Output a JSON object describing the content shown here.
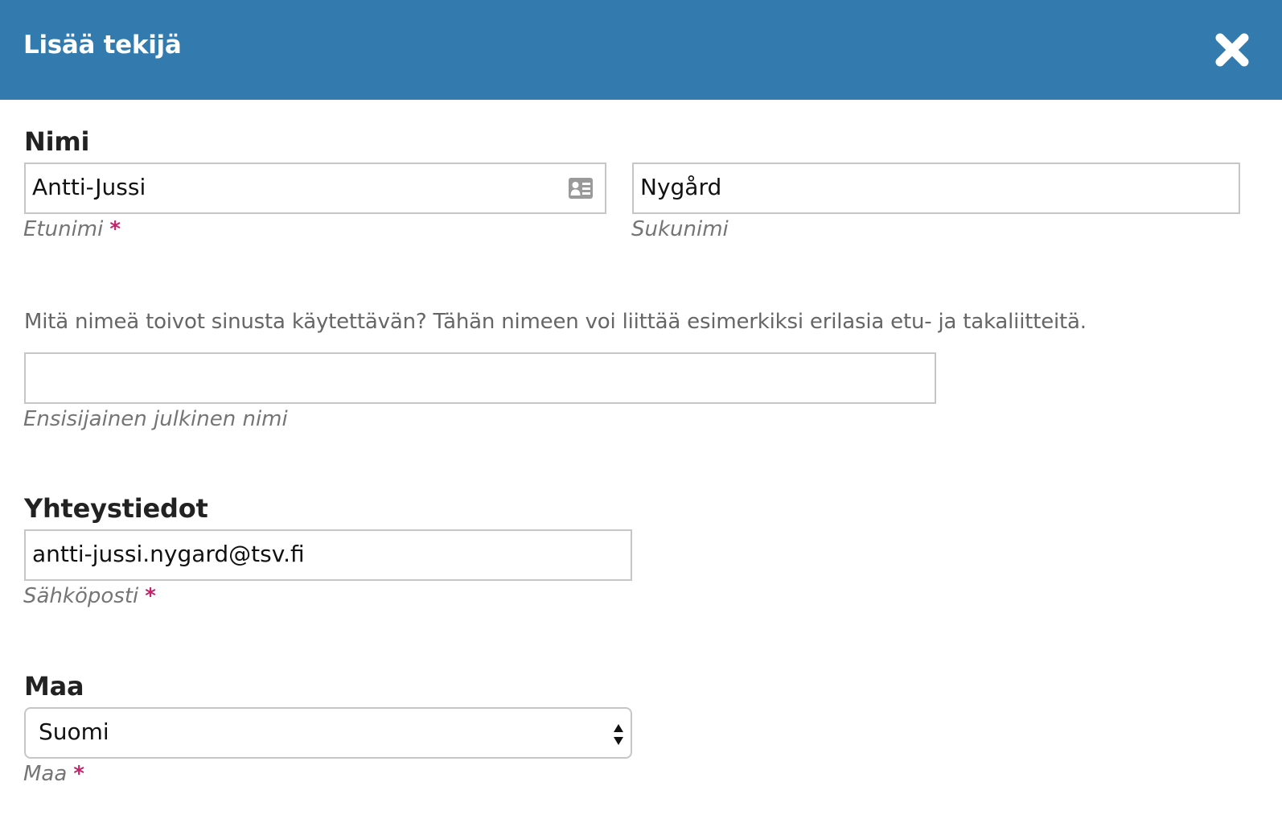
{
  "dialog": {
    "title": "Lisää tekijä",
    "close_icon": "close-icon",
    "header_color": "#337aae",
    "required_color": "#c1246a"
  },
  "name_section": {
    "label": "Nimi",
    "given_name": {
      "value": "Antti-Jussi",
      "hint": "Etunimi",
      "required_mark": "*",
      "icon": "contact-card-icon"
    },
    "family_name": {
      "value": "Nygård",
      "hint": "Sukunimi"
    },
    "preferred_description": "Mitä nimeä toivot sinusta käytettävän? Tähän nimeen voi liittää esimerkiksi erilasia etu- ja takaliitteitä.",
    "preferred_name": {
      "value": "",
      "hint": "Ensisijainen julkinen nimi"
    }
  },
  "contact_section": {
    "label": "Yhteystiedot",
    "email": {
      "value": "antti-jussi.nygard@tsv.fi",
      "hint": "Sähköposti",
      "required_mark": "*"
    }
  },
  "country_section": {
    "label": "Maa",
    "country": {
      "selected": "Suomi",
      "hint": "Maa",
      "required_mark": "*",
      "icon": "select-arrows-icon"
    }
  }
}
